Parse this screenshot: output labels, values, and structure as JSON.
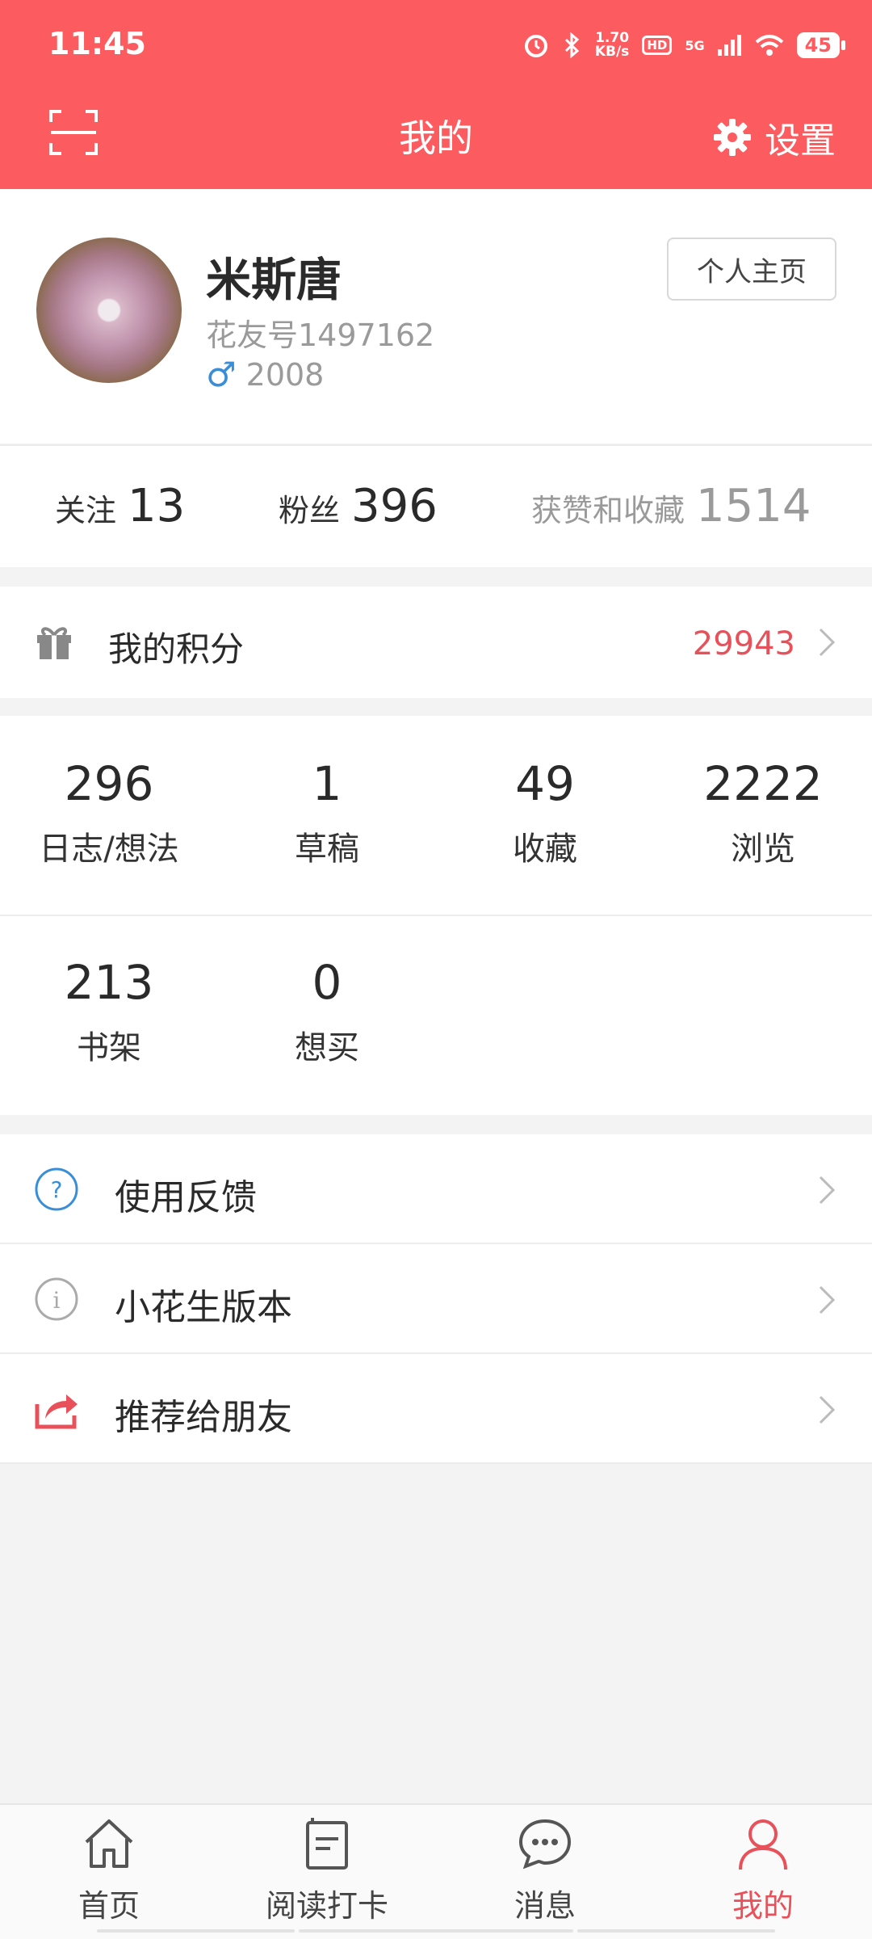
{
  "status_bar": {
    "time": "11:45",
    "speed_top": "1.70",
    "speed_bottom": "KB/s",
    "hd": "HD",
    "network": "5G",
    "battery": "45"
  },
  "header": {
    "title": "我的",
    "settings_label": "设置"
  },
  "profile": {
    "name": "米斯唐",
    "user_id": "花友号1497162",
    "year": "2008",
    "gender_symbol": "♂",
    "homepage_button": "个人主页"
  },
  "social": {
    "following_label": "关注",
    "following_count": "13",
    "fans_label": "粉丝",
    "fans_count": "396",
    "likes_label": "获赞和收藏",
    "likes_count": "1514"
  },
  "points": {
    "label": "我的积分",
    "value": "29943"
  },
  "counts": [
    {
      "value": "296",
      "label": "日志/想法"
    },
    {
      "value": "1",
      "label": "草稿"
    },
    {
      "value": "49",
      "label": "收藏"
    },
    {
      "value": "2222",
      "label": "浏览"
    },
    {
      "value": "213",
      "label": "书架"
    },
    {
      "value": "0",
      "label": "想买"
    }
  ],
  "menu": [
    {
      "label": "使用反馈",
      "icon": "help-icon"
    },
    {
      "label": "小花生版本",
      "icon": "info-icon"
    },
    {
      "label": "推荐给朋友",
      "icon": "share-icon"
    }
  ],
  "bottom_nav": [
    {
      "label": "首页",
      "icon": "home-icon"
    },
    {
      "label": "阅读打卡",
      "icon": "book-icon"
    },
    {
      "label": "消息",
      "icon": "chat-icon"
    },
    {
      "label": "我的",
      "icon": "user-icon",
      "active": true
    }
  ],
  "colors": {
    "brand": "#fc5c5f",
    "accent_text": "#e8505a",
    "link_blue": "#3a8ed8"
  }
}
